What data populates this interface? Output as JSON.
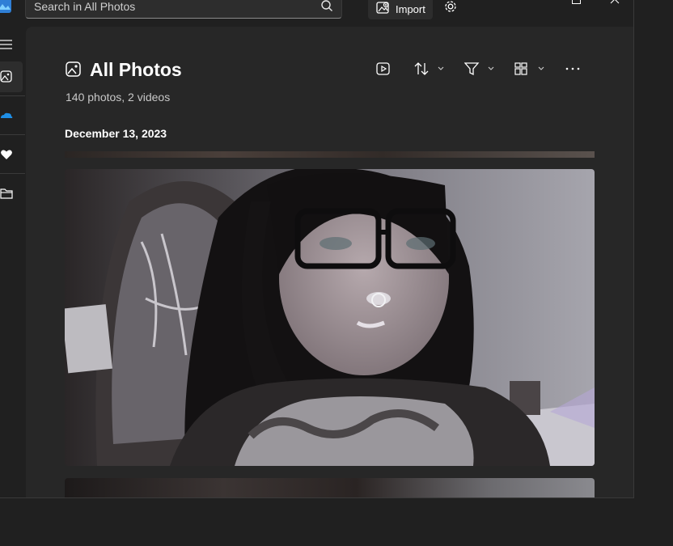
{
  "search": {
    "placeholder": "Search in All Photos"
  },
  "titlebar": {
    "import_label": "Import",
    "icons": [
      "photos-app-logo",
      "search-icon",
      "import-icon",
      "gear-icon",
      "maximize-icon",
      "close-icon"
    ]
  },
  "nav": {
    "items": [
      "hamburger-menu-icon",
      "all-photos-icon",
      "onedrive-icon",
      "favorites-heart-icon",
      "folders-icon"
    ]
  },
  "header": {
    "title": "All Photos",
    "subtitle": "140 photos, 2 videos"
  },
  "toolbar": {
    "icons": [
      "slideshow-icon",
      "sort-icon",
      "filter-icon",
      "view-layout-icon",
      "more-options-icon"
    ]
  },
  "gallery": {
    "group_date": "December 13, 2023"
  },
  "colors": {
    "background": "#202020",
    "content": "#272727",
    "accent": "#ffffff"
  }
}
